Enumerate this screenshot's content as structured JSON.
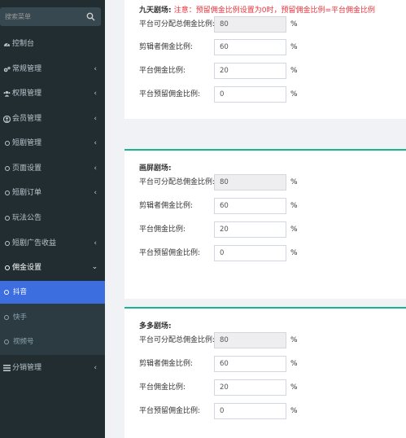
{
  "sidebar": {
    "search_placeholder": "搜索菜单",
    "items": [
      {
        "label": "控制台",
        "icon": "dashboard-icon"
      },
      {
        "label": "常规管理",
        "icon": "cogs-icon"
      },
      {
        "label": "权限管理",
        "icon": "group-icon"
      },
      {
        "label": "会员管理",
        "icon": "user-icon"
      },
      {
        "label": "短剧管理",
        "icon": "circle-icon"
      },
      {
        "label": "页面设置",
        "icon": "circle-icon"
      },
      {
        "label": "短剧订单",
        "icon": "circle-icon"
      },
      {
        "label": "玩法公告",
        "icon": "circle-icon"
      },
      {
        "label": "短剧广告收益",
        "icon": "circle-icon"
      },
      {
        "label": "佣金设置",
        "icon": "circle-icon"
      },
      {
        "label": "分销管理",
        "icon": "list-icon"
      }
    ],
    "submenu": [
      {
        "label": "抖音",
        "active": true
      },
      {
        "label": "快手",
        "active": false
      },
      {
        "label": "视频号",
        "active": false
      }
    ]
  },
  "sections": [
    {
      "title": "九天剧场:",
      "notice": "注意：预留佣金比例设置为0时，预留佣金比例=平台佣金比例",
      "rows": [
        {
          "label": "平台可分配总佣金比例:",
          "value": "80",
          "unit": "%"
        },
        {
          "label": "剪辑者佣金比例:",
          "value": "60",
          "unit": "%"
        },
        {
          "label": "平台佣金比例:",
          "value": "20",
          "unit": "%"
        },
        {
          "label": "平台预留佣金比例:",
          "value": "0",
          "unit": "%"
        }
      ]
    },
    {
      "title": "画屏剧场:",
      "rows": [
        {
          "label": "平台可分配总佣金比例:",
          "value": "80",
          "unit": "%"
        },
        {
          "label": "剪辑者佣金比例:",
          "value": "60",
          "unit": "%"
        },
        {
          "label": "平台佣金比例:",
          "value": "20",
          "unit": "%"
        },
        {
          "label": "平台预留佣金比例:",
          "value": "0",
          "unit": "%"
        }
      ]
    },
    {
      "title": "多多剧场:",
      "rows": [
        {
          "label": "平台可分配总佣金比例:",
          "value": "80",
          "unit": "%"
        },
        {
          "label": "剪辑者佣金比例:",
          "value": "60",
          "unit": "%"
        },
        {
          "label": "平台佣金比例:",
          "value": "20",
          "unit": "%"
        },
        {
          "label": "平台预留佣金比例:",
          "value": "0",
          "unit": "%"
        }
      ]
    }
  ],
  "colors": {
    "sidebar_bg": "#222d32",
    "active_bg": "#3c6ee0",
    "accent_green": "#1ab394",
    "notice_red": "#e8323c"
  }
}
